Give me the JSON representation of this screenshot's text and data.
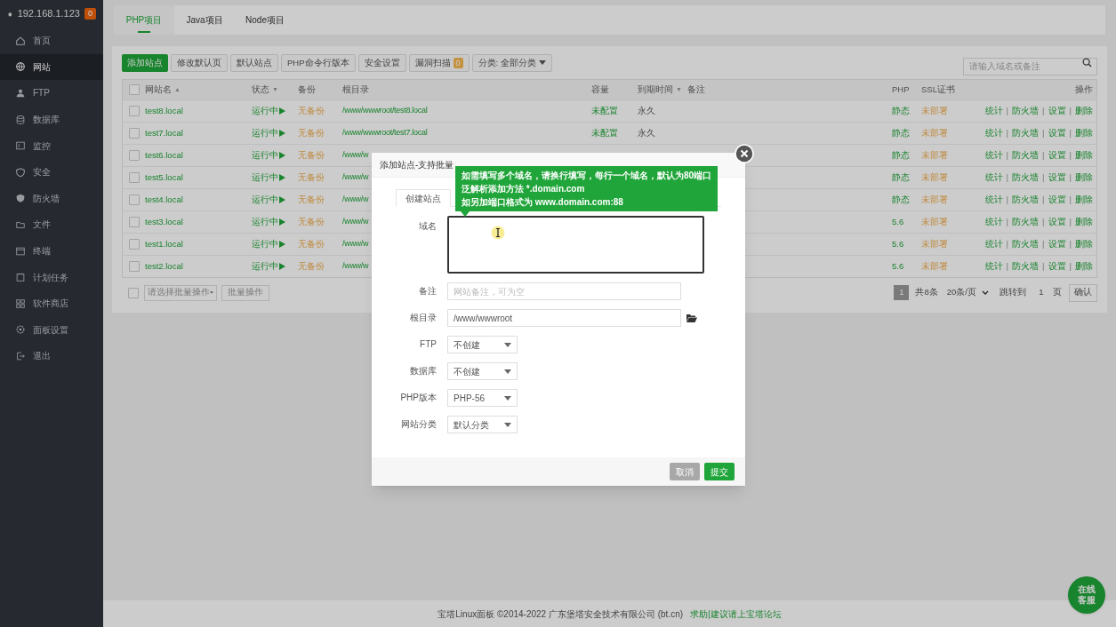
{
  "sidebar": {
    "host": "192.168.1.123",
    "badge": "0",
    "items": [
      {
        "label": "首页",
        "selected": false
      },
      {
        "label": "网站",
        "selected": true
      },
      {
        "label": "FTP",
        "selected": false
      },
      {
        "label": "数据库",
        "selected": false
      },
      {
        "label": "监控",
        "selected": false
      },
      {
        "label": "安全",
        "selected": false
      },
      {
        "label": "防火墙",
        "selected": false
      },
      {
        "label": "文件",
        "selected": false
      },
      {
        "label": "终端",
        "selected": false
      },
      {
        "label": "计划任务",
        "selected": false
      },
      {
        "label": "软件商店",
        "selected": false
      },
      {
        "label": "面板设置",
        "selected": false
      },
      {
        "label": "退出",
        "selected": false
      }
    ]
  },
  "tabs": [
    {
      "label": "PHP项目",
      "selected": true
    },
    {
      "label": "Java项目",
      "selected": false
    },
    {
      "label": "Node项目",
      "selected": false
    }
  ],
  "toolbar": {
    "buttons": [
      {
        "label": "添加站点",
        "kind": "primary"
      },
      {
        "label": "修改默认页",
        "kind": "default"
      },
      {
        "label": "默认站点",
        "kind": "default"
      },
      {
        "label": "PHP命令行版本",
        "kind": "default"
      },
      {
        "label": "安全设置",
        "kind": "default"
      },
      {
        "label": "漏洞扫描",
        "kind": "badge",
        "badge": "0"
      },
      {
        "label": "分类: 全部分类",
        "kind": "dropdown"
      }
    ],
    "search_placeholder": "请输入域名或备注"
  },
  "table": {
    "columns": [
      {
        "label": "网站名",
        "sort_icon": "▲"
      },
      {
        "label": "状态",
        "sort_icon": "▼"
      },
      {
        "label": "备份"
      },
      {
        "label": "根目录"
      },
      {
        "label": "容量"
      },
      {
        "label": "到期时间",
        "sort_icon": "▼"
      },
      {
        "label": "备注"
      },
      {
        "label": "PHP"
      },
      {
        "label": "SSL证书"
      },
      {
        "label": "操作"
      }
    ],
    "select_all_checked": false,
    "action_separator": "|",
    "rows": [
      {
        "name": "test8.local",
        "checked": false,
        "status": "运行中",
        "backup": "无备份",
        "root": "/www/wwwroot/test8.local",
        "capacity": "未配置",
        "expiry": "永久",
        "php": "静态",
        "ssl": "未部署",
        "actions": [
          "统计",
          "防火墙",
          "设置",
          "删除"
        ]
      },
      {
        "name": "test7.local",
        "checked": false,
        "status": "运行中",
        "backup": "无备份",
        "root": "/www/wwwroot/test7.local",
        "capacity": "未配置",
        "expiry": "永久",
        "php": "静态",
        "ssl": "未部署",
        "actions": [
          "统计",
          "防火墙",
          "设置",
          "删除"
        ]
      },
      {
        "name": "test6.local",
        "checked": false,
        "status": "运行中",
        "backup": "无备份",
        "root": "/www/w",
        "php": "静态",
        "ssl": "未部署",
        "actions": [
          "统计",
          "防火墙",
          "设置",
          "删除"
        ]
      },
      {
        "name": "test5.local",
        "checked": false,
        "status": "运行中",
        "backup": "无备份",
        "root": "/www/w",
        "php": "静态",
        "ssl": "未部署",
        "actions": [
          "统计",
          "防火墙",
          "设置",
          "删除"
        ]
      },
      {
        "name": "test4.local",
        "checked": false,
        "status": "运行中",
        "backup": "无备份",
        "root": "/www/w",
        "php": "静态",
        "ssl": "未部署",
        "actions": [
          "统计",
          "防火墙",
          "设置",
          "删除"
        ]
      },
      {
        "name": "test3.local",
        "checked": false,
        "status": "运行中",
        "backup": "无备份",
        "root": "/www/w",
        "php": "5.6",
        "ssl": "未部署",
        "actions": [
          "统计",
          "防火墙",
          "设置",
          "删除"
        ]
      },
      {
        "name": "test1.local",
        "checked": false,
        "status": "运行中",
        "backup": "无备份",
        "root": "/www/w",
        "php": "5.6",
        "ssl": "未部署",
        "actions": [
          "统计",
          "防火墙",
          "设置",
          "删除"
        ]
      },
      {
        "name": "test2.local",
        "checked": false,
        "status": "运行中",
        "backup": "无备份",
        "root": "/www/w",
        "php": "5.6",
        "ssl": "未部署",
        "actions": [
          "统计",
          "防火墙",
          "设置",
          "删除"
        ]
      }
    ]
  },
  "batch": {
    "checked": false,
    "select_placeholder": "请选择批量操作",
    "button": "批量操作"
  },
  "pagination": {
    "current": "1",
    "total": "共8条",
    "per_page": "20条/页",
    "jump_label": "跳转到",
    "jump_value": "1",
    "page_unit": "页",
    "confirm": "确认"
  },
  "dialog": {
    "title": "添加站点-支持批量",
    "tooltip": [
      "如需填写多个域名，请换行填写，每行一个域名，默认为80端口",
      "泛解析添加方法 *.domain.com",
      "如另加端口格式为 www.domain.com:88"
    ],
    "tabs": [
      {
        "label": "创建站点",
        "selected": true
      }
    ],
    "fields": [
      {
        "label": "域名",
        "kind": "textarea"
      },
      {
        "label": "备注",
        "kind": "input",
        "placeholder": "网站备注，可为空"
      },
      {
        "label": "根目录",
        "kind": "path",
        "value": "/www/wwwroot"
      },
      {
        "label": "FTP",
        "kind": "select",
        "value": "不创建"
      },
      {
        "label": "数据库",
        "kind": "select",
        "value": "不创建"
      },
      {
        "label": "PHP版本",
        "kind": "select",
        "value": "PHP-56"
      },
      {
        "label": "网站分类",
        "kind": "select",
        "value": "默认分类"
      }
    ],
    "buttons": [
      {
        "label": "取消",
        "kind": "cancel"
      },
      {
        "label": "提交",
        "kind": "submit"
      }
    ]
  },
  "footer": {
    "copyright": "宝塔Linux面板 ©2014-2022 广东堡塔安全技术有限公司 (bt.cn)",
    "link": "求助|建议请上宝塔论坛"
  },
  "chat_button": "在线客服"
}
